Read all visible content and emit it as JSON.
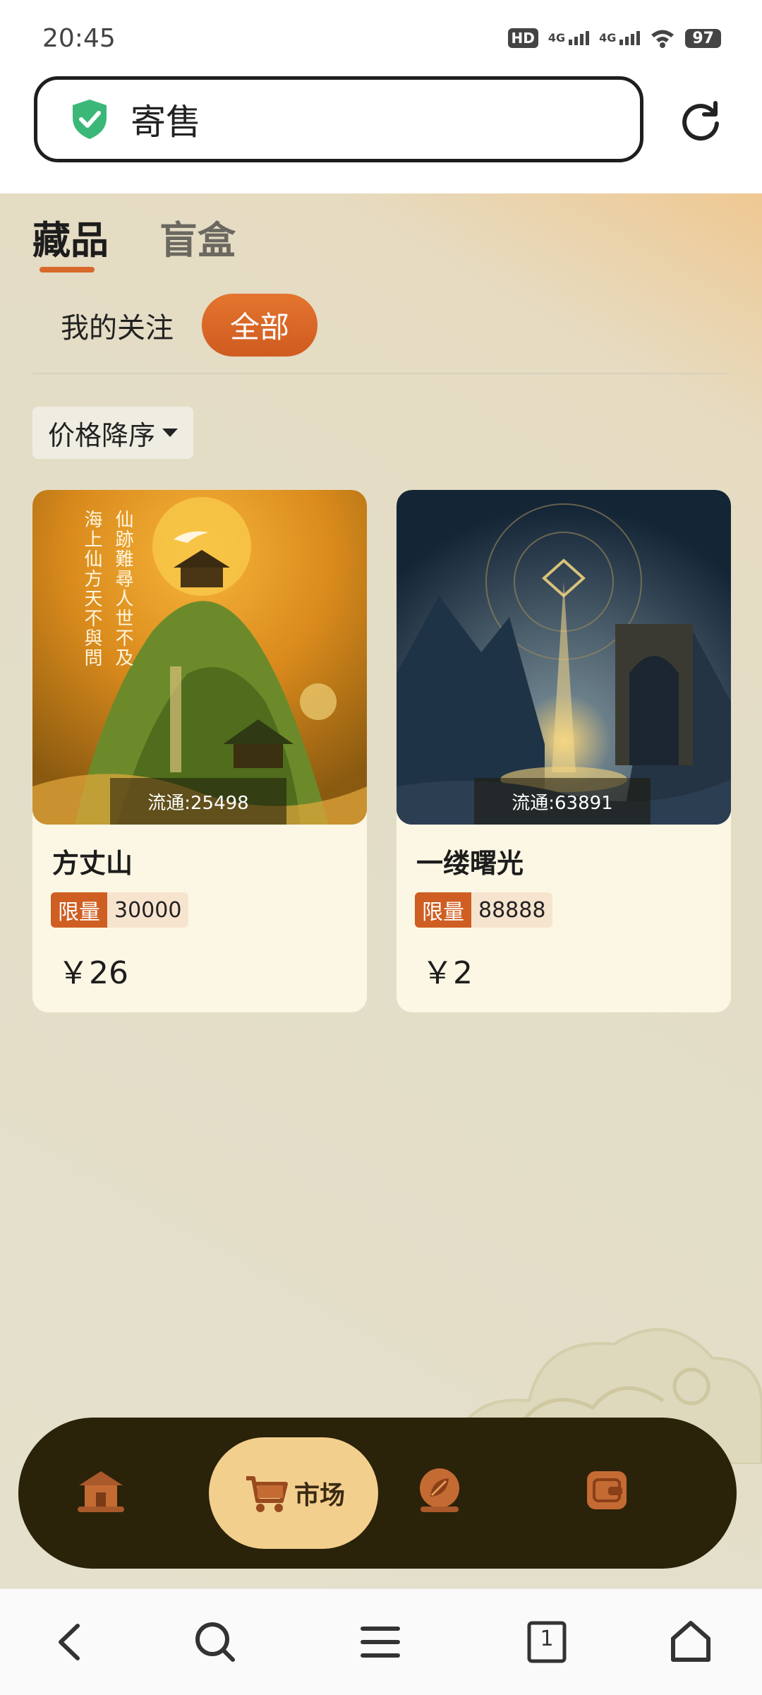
{
  "status_bar": {
    "time": "20:45",
    "hd_label": "HD",
    "net1": "4G",
    "net2": "4G",
    "battery": "97"
  },
  "address_bar": {
    "text": "寄售",
    "secure_icon": "shield-check-icon",
    "reload_icon": "reload-icon"
  },
  "tabs": [
    {
      "label": "藏品",
      "active": true
    },
    {
      "label": "盲盒",
      "active": false
    }
  ],
  "filters": {
    "follow": "我的关注",
    "all": "全部"
  },
  "sort": {
    "label": "价格降序"
  },
  "items": [
    {
      "name": "方丈山",
      "circulation": "流通:25498",
      "limit_label": "限量",
      "limit_value": "30000",
      "price": "￥26",
      "poem_col1": "海上仙方天不與問",
      "poem_col2": "仙跡難尋人世不及"
    },
    {
      "name": "一缕曙光",
      "circulation": "流通:63891",
      "limit_label": "限量",
      "limit_value": "88888",
      "price": "￥2"
    }
  ],
  "app_nav": {
    "active_label": "市场",
    "icons": [
      "home-pavilion-icon",
      "market-cart-icon",
      "leaf-emblem-icon",
      "wallet-icon"
    ]
  },
  "system_nav": {
    "tab_count": "1"
  },
  "colors": {
    "accent": "#d8692b",
    "nav_bg": "#2a2209",
    "nav_active": "#f3cf8e",
    "card_bg": "#fcf7e4"
  }
}
